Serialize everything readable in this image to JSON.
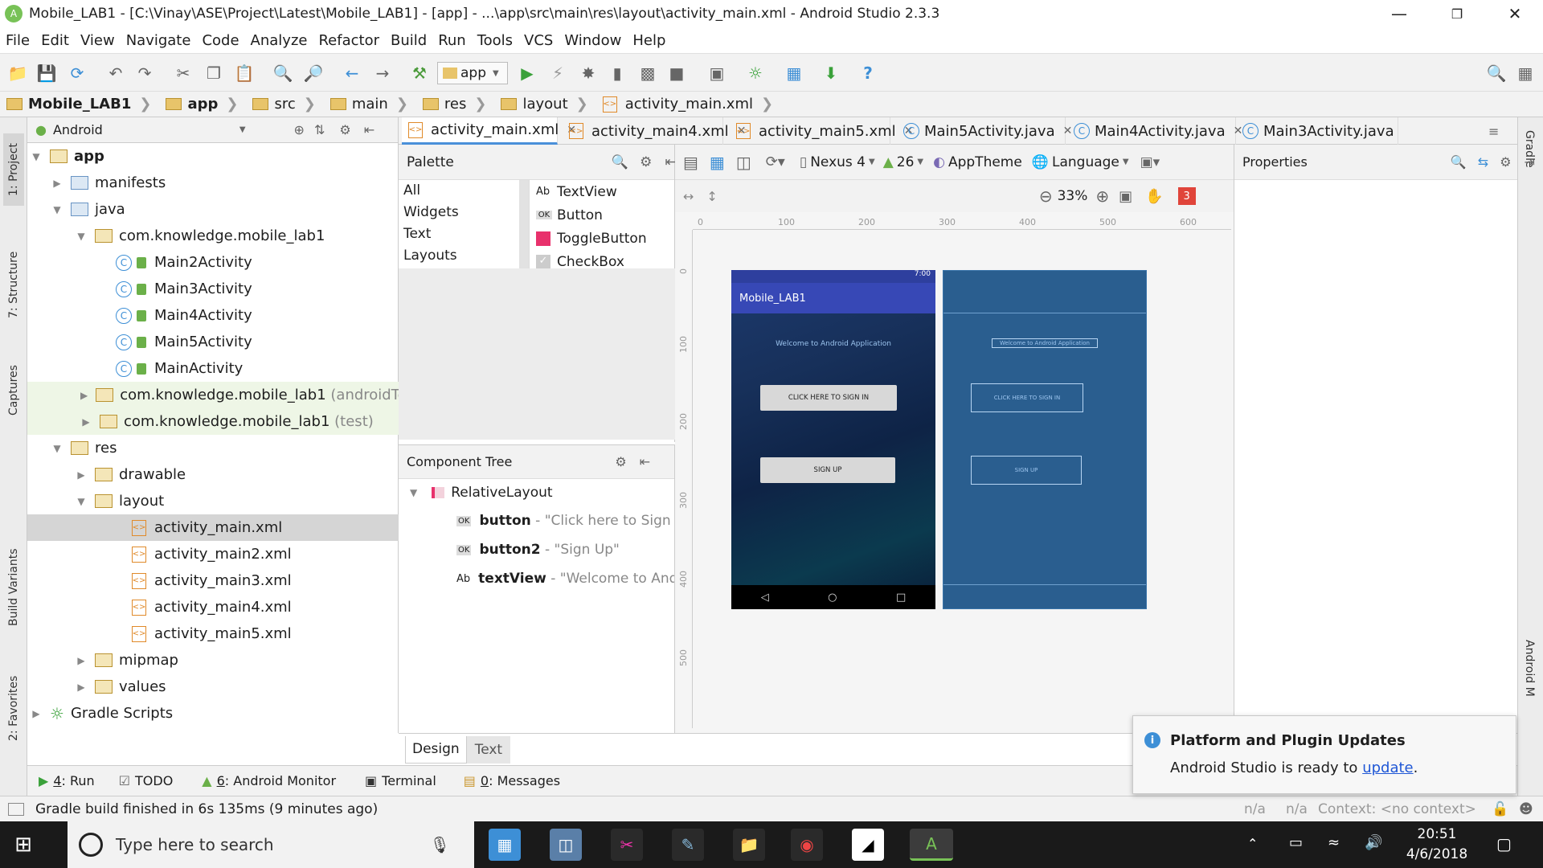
{
  "window": {
    "title": "Mobile_LAB1 - [C:\\Vinay\\ASE\\Project\\Latest\\Mobile_LAB1] - [app] - ...\\app\\src\\main\\res\\layout\\activity_main.xml - Android Studio 2.3.3"
  },
  "menu": [
    "File",
    "Edit",
    "View",
    "Navigate",
    "Code",
    "Analyze",
    "Refactor",
    "Build",
    "Run",
    "Tools",
    "VCS",
    "Window",
    "Help"
  ],
  "toolbar": {
    "run_config": "app"
  },
  "breadcrumbs": [
    "Mobile_LAB1",
    "app",
    "src",
    "main",
    "res",
    "layout",
    "activity_main.xml"
  ],
  "left_tabs": {
    "project": "1: Project",
    "structure": "7: Structure",
    "captures": "Captures",
    "build_variants": "Build Variants",
    "favorites": "2: Favorites"
  },
  "right_tabs": {
    "gradle": "Gradle",
    "android_model": "Android M"
  },
  "project_panel": {
    "view": "Android",
    "tree": {
      "app": "app",
      "manifests": "manifests",
      "java": "java",
      "pkg": "com.knowledge.mobile_lab1",
      "classes": [
        "Main2Activity",
        "Main3Activity",
        "Main4Activity",
        "Main5Activity",
        "MainActivity"
      ],
      "pkg_android_test": "com.knowledge.mobile_lab1",
      "android_test_suffix": "(androidTest)",
      "pkg_test": "com.knowledge.mobile_lab1",
      "test_suffix": "(test)",
      "res": "res",
      "drawable": "drawable",
      "layout": "layout",
      "layouts": [
        "activity_main.xml",
        "activity_main2.xml",
        "activity_main3.xml",
        "activity_main4.xml",
        "activity_main5.xml"
      ],
      "mipmap": "mipmap",
      "values": "values",
      "gradle_scripts": "Gradle Scripts"
    }
  },
  "editor_tabs": [
    "activity_main.xml",
    "activity_main4.xml",
    "activity_main5.xml",
    "Main5Activity.java",
    "Main4Activity.java",
    "Main3Activity.java"
  ],
  "palette": {
    "title": "Palette",
    "categories": [
      "All",
      "Widgets",
      "Text",
      "Layouts"
    ],
    "widgets": [
      {
        "icon": "Ab",
        "label": "TextView"
      },
      {
        "icon": "OK",
        "label": "Button"
      },
      {
        "icon": "",
        "label": "ToggleButton"
      },
      {
        "icon": "",
        "label": "CheckBox"
      }
    ]
  },
  "component_tree": {
    "title": "Component Tree",
    "root": "RelativeLayout",
    "items": [
      {
        "icon": "OK",
        "id": "button",
        "text": "- \"Click here to Sign In"
      },
      {
        "icon": "OK",
        "id": "button2",
        "text": "- \"Sign Up\""
      },
      {
        "icon": "Ab",
        "id": "textView",
        "text": "- \"Welcome to Andr"
      }
    ]
  },
  "design_toolbar": {
    "device": "Nexus 4",
    "api": "26",
    "theme": "AppTheme",
    "language": "Language",
    "zoom": "33%",
    "errors": "3"
  },
  "ruler": {
    "h": [
      "0",
      "100",
      "200",
      "300",
      "400",
      "500",
      "600"
    ],
    "v": [
      "0",
      "100",
      "200",
      "300",
      "400",
      "500"
    ]
  },
  "phone": {
    "time": "7:00",
    "app_title": "Mobile_LAB1",
    "welcome": "Welcome to Android Application",
    "sign_in": "CLICK HERE TO SIGN IN",
    "sign_up": "SIGN UP"
  },
  "blueprint": {
    "welcome": "Welcome to Android Application",
    "sign_in": "CLICK HERE TO SIGN IN",
    "sign_up": "SIGN UP"
  },
  "properties": {
    "title": "Properties"
  },
  "design_text_tabs": [
    "Design",
    "Text"
  ],
  "tool_windows": [
    {
      "key": "4",
      "label": ": Run"
    },
    {
      "key": "",
      "label": "TODO"
    },
    {
      "key": "6",
      "label": ": Android Monitor"
    },
    {
      "key": "",
      "label": "Terminal"
    },
    {
      "key": "0",
      "label": ": Messages"
    }
  ],
  "status": {
    "message": "Gradle build finished in 6s 135ms (9 minutes ago)",
    "na1": "n/a",
    "na2": "n/a",
    "context": "Context: <no context>"
  },
  "notification": {
    "title": "Platform and Plugin Updates",
    "body": "Android Studio is ready to",
    "link": "update",
    "period": "."
  },
  "taskbar": {
    "search_placeholder": "Type here to search",
    "time": "20:51",
    "date": "4/6/2018"
  },
  "colors": {
    "accent": "#4a90d9",
    "appbar": "#3748b6",
    "blueprint": "#2a5e8f",
    "error_badge": "#e0443a",
    "selection": "#d5d5d5"
  }
}
